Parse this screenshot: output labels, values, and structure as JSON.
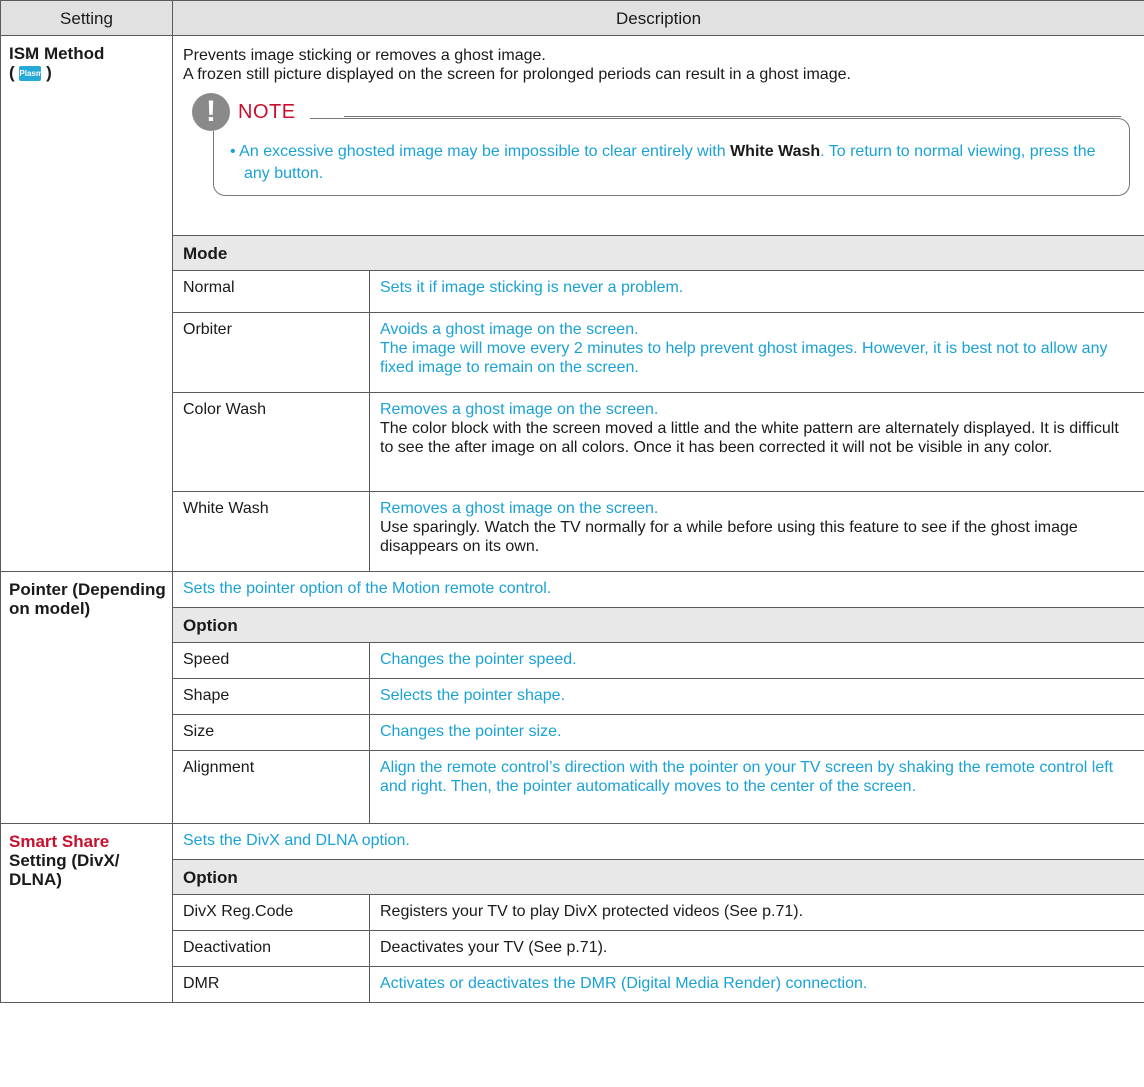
{
  "header": {
    "setting": "Setting",
    "description": "Description"
  },
  "ism": {
    "label": "ISM Method",
    "paren_open": "(",
    "paren_close": ")",
    "icon_text": "Plasma",
    "line1": "Prevents image sticking or removes a ghost image.",
    "line2": "A frozen still picture displayed on the screen for prolonged periods can result in a ghost image.",
    "note_title": "NOTE",
    "note_pre": "An excessive ghosted image may be impossible to clear entirely with ",
    "note_bold": "White Wash",
    "note_post": ". To return to normal viewing, press the any button.",
    "mode_head": "Mode",
    "modes": [
      {
        "name": "Normal",
        "line1": "Sets it if image sticking is never a problem.",
        "line2": ""
      },
      {
        "name": "Orbiter",
        "line1": "Avoids a ghost image on the screen.",
        "line2": "The image will move every 2 minutes to help prevent ghost images. However, it is best not to allow any fixed image to remain on the screen."
      },
      {
        "name": "Color Wash",
        "line1": "Removes a ghost image on the screen.",
        "line2": "The color block with the screen moved a little and the white pattern are alternately displayed. It is difficult to see the after image on all colors. Once it has been corrected it will not be visible in any color."
      },
      {
        "name": "White Wash",
        "line1": "Removes a ghost image on the screen.",
        "line2": "Use sparingly. Watch the TV normally for a while before using this feature to see if the ghost image disappears on its own."
      }
    ]
  },
  "pointer": {
    "label": "Pointer (Depending on model)",
    "desc": "Sets the pointer option of the Motion remote control.",
    "option_head": "Option",
    "options": [
      {
        "name": "Speed",
        "desc": "Changes the pointer speed."
      },
      {
        "name": "Shape",
        "desc": "Selects the pointer shape."
      },
      {
        "name": "Size",
        "desc": "Changes the pointer size."
      },
      {
        "name": "Alignment",
        "desc": "Align the remote control’s direction with the pointer on your TV screen by shaking the remote control left and right. Then, the pointer automatically moves to the center of the screen."
      }
    ]
  },
  "smart": {
    "label_red": "Smart Share",
    "label_rest": "Setting (DivX/ DLNA)",
    "desc": "Sets the DivX and DLNA option.",
    "option_head": "Option",
    "options": [
      {
        "name": "DivX Reg.Code",
        "desc": "Registers your TV to play DivX protected videos (See p.71).",
        "blue": false
      },
      {
        "name": "Deactivation",
        "desc": "Deactivates your TV (See p.71).",
        "blue": false
      },
      {
        "name": "DMR",
        "desc": "Activates or deactivates the DMR (Digital Media Render) connection.",
        "blue": true
      }
    ]
  }
}
